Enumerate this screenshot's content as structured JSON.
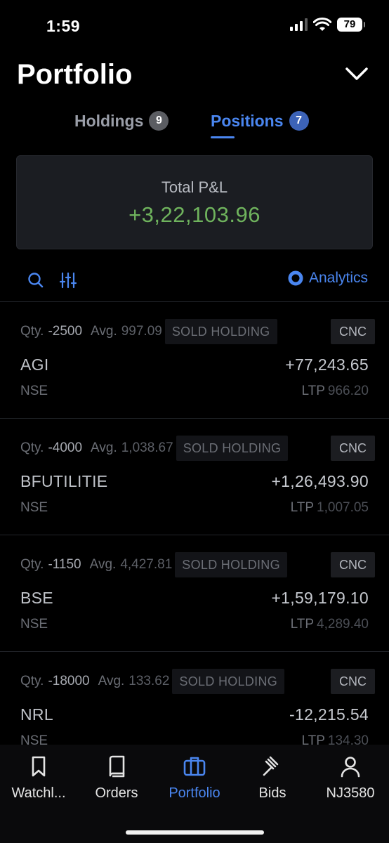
{
  "status_bar": {
    "time": "1:59",
    "battery": "79"
  },
  "header": {
    "title": "Portfolio"
  },
  "tabs": [
    {
      "label": "Holdings",
      "badge": "9",
      "active": false
    },
    {
      "label": "Positions",
      "badge": "7",
      "active": true
    }
  ],
  "summary": {
    "label": "Total P&L",
    "value": "+3,22,103.96"
  },
  "toolbar": {
    "analytics_label": "Analytics"
  },
  "labels": {
    "qty": "Qty.",
    "avg": "Avg.",
    "ltp": "LTP"
  },
  "positions": [
    {
      "qty": "-2500",
      "avg": "997.09",
      "tag": "SOLD HOLDING",
      "product": "CNC",
      "symbol": "AGI",
      "pnl": "+77,243.65",
      "exchange": "NSE",
      "ltp": "966.20"
    },
    {
      "qty": "-4000",
      "avg": "1,038.67",
      "tag": "SOLD HOLDING",
      "product": "CNC",
      "symbol": "BFUTILITIE",
      "pnl": "+1,26,493.90",
      "exchange": "NSE",
      "ltp": "1,007.05"
    },
    {
      "qty": "-1150",
      "avg": "4,427.81",
      "tag": "SOLD HOLDING",
      "product": "CNC",
      "symbol": "BSE",
      "pnl": "+1,59,179.10",
      "exchange": "NSE",
      "ltp": "4,289.40"
    },
    {
      "qty": "-18000",
      "avg": "133.62",
      "tag": "SOLD HOLDING",
      "product": "CNC",
      "symbol": "NRL",
      "pnl": "-12,215.54",
      "exchange": "NSE",
      "ltp": "134.30"
    }
  ],
  "bottom_nav": [
    {
      "label": "Watchl...",
      "icon": "bookmark-icon",
      "active": false
    },
    {
      "label": "Orders",
      "icon": "book-icon",
      "active": false
    },
    {
      "label": "Portfolio",
      "icon": "briefcase-icon",
      "active": true
    },
    {
      "label": "Bids",
      "icon": "gavel-icon",
      "active": false
    },
    {
      "label": "NJ3580",
      "icon": "user-icon",
      "active": false
    }
  ],
  "colors": {
    "accent": "#4a86f0",
    "profit": "#6fb35d",
    "background": "#000000",
    "card": "#1b1d22"
  }
}
